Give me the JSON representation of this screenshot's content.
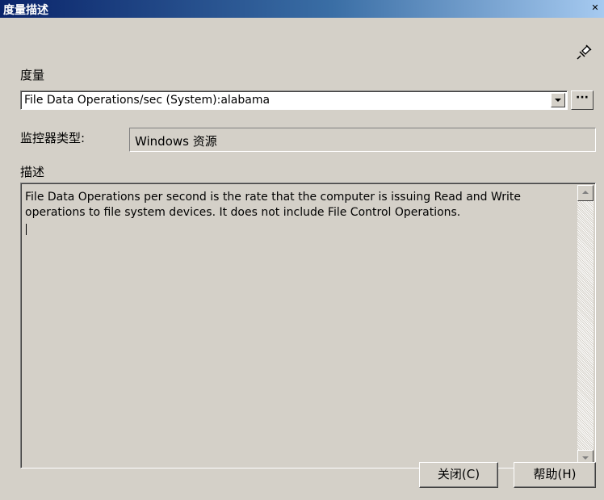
{
  "window": {
    "title": "度量描述",
    "close_glyph": "✕"
  },
  "metric": {
    "label": "度量",
    "value": "File Data Operations/sec (System):alabama",
    "browse_label": "···"
  },
  "monitor_type": {
    "label": "监控器类型:",
    "value": "Windows 资源"
  },
  "description": {
    "label": "描述",
    "text": "File Data Operations per second is the rate that the computer is issuing Read and Write operations to file system devices.  It does not include File Control Operations."
  },
  "buttons": {
    "close": "关闭(C)",
    "help": "帮助(H)"
  },
  "icons": {
    "pin": "pin-icon"
  },
  "colors": {
    "title_start": "#0a246a",
    "title_end": "#a6caf0",
    "face": "#d4d0c8"
  }
}
